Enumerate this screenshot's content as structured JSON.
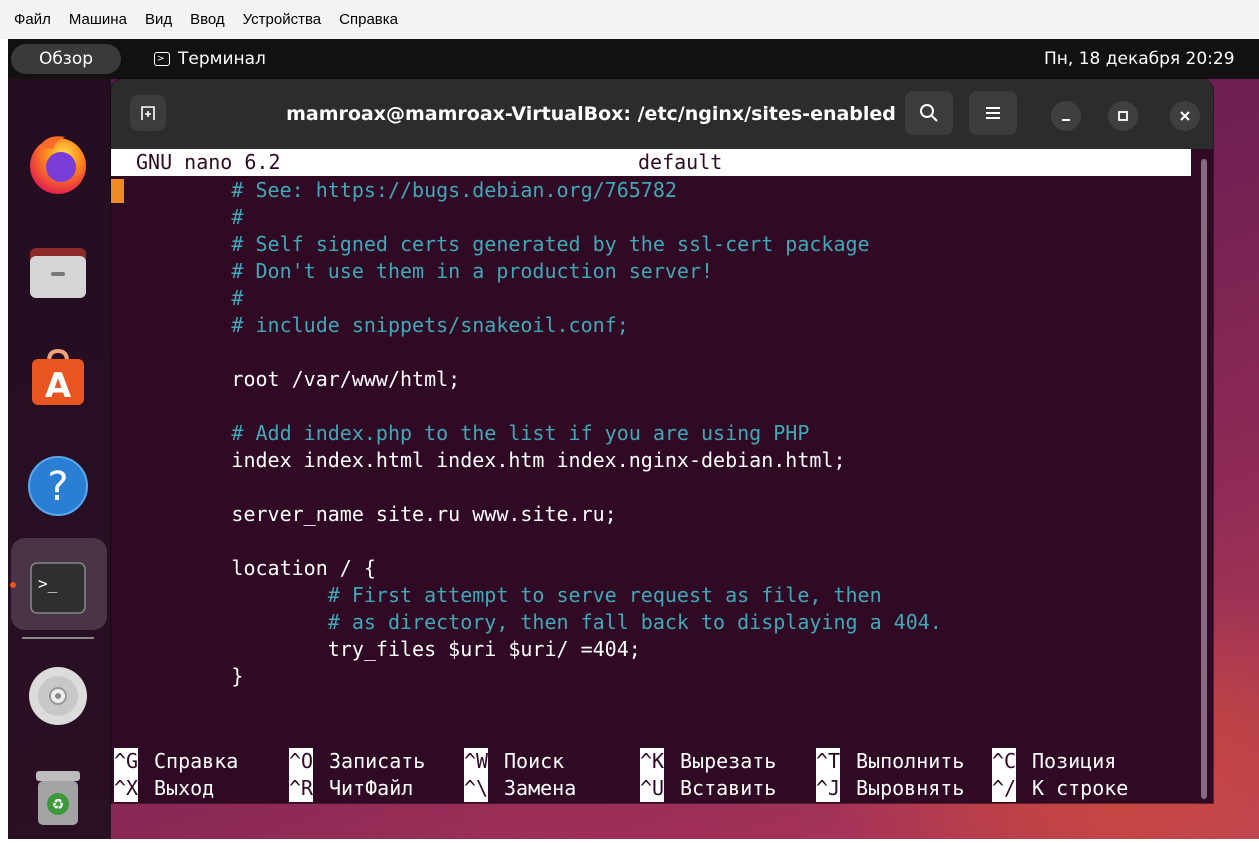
{
  "vbox_menu": [
    "Файл",
    "Машина",
    "Вид",
    "Ввод",
    "Устройства",
    "Справка"
  ],
  "topbar": {
    "overview": "Обзор",
    "app_name": "Терминал",
    "clock": "Пн, 18 декабря 20:29"
  },
  "dock": {
    "items": [
      "firefox-icon",
      "files-icon",
      "app-center-icon",
      "help-icon",
      "terminal-icon",
      "disc-icon",
      "trash-icon"
    ],
    "running_dot_color": "#e95420"
  },
  "terminal": {
    "title": "mamroax@mamroax-VirtualBox: /etc/nginx/sites-enabled",
    "background": "#300a24",
    "comment_color": "#3fa9b8"
  },
  "nano": {
    "version": "GNU nano 6.2",
    "filename": "default",
    "lines": [
      "        # See: https://bugs.debian.org/765782",
      "        #",
      "        # Self signed certs generated by the ssl-cert package",
      "        # Don't use them in a production server!",
      "        #",
      "        # include snippets/snakeoil.conf;",
      "",
      "        root /var/www/html;",
      "",
      "        # Add index.php to the list if you are using PHP",
      "        index index.html index.htm index.nginx-debian.html;",
      "",
      "        server_name site.ru www.site.ru;",
      "",
      "        location / {",
      "                # First attempt to serve request as file, then",
      "                # as directory, then fall back to displaying a 404.",
      "                try_files $uri $uri/ =404;",
      "        }"
    ],
    "shortcuts_row1": [
      {
        "key": "^G",
        "label": "Справка"
      },
      {
        "key": "^O",
        "label": "Записать"
      },
      {
        "key": "^W",
        "label": "Поиск"
      },
      {
        "key": "^K",
        "label": "Вырезать"
      },
      {
        "key": "^T",
        "label": "Выполнить"
      },
      {
        "key": "^C",
        "label": "Позиция"
      }
    ],
    "shortcuts_row2": [
      {
        "key": "^X",
        "label": "Выход"
      },
      {
        "key": "^R",
        "label": "ЧитФайл"
      },
      {
        "key": "^\\",
        "label": "Замена"
      },
      {
        "key": "^U",
        "label": "Вставить"
      },
      {
        "key": "^J",
        "label": "Выровнять"
      },
      {
        "key": "^/",
        "label": "К строке"
      }
    ]
  }
}
